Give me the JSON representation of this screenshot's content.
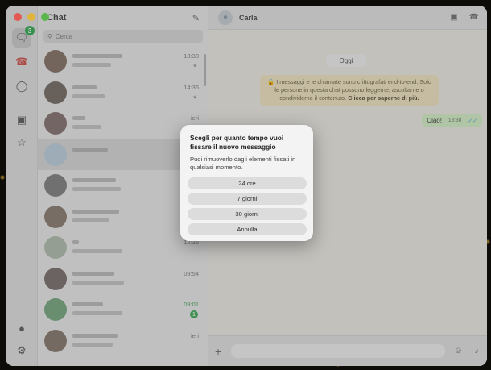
{
  "window": {
    "lights": [
      "close",
      "minimize",
      "zoom"
    ]
  },
  "rail": {
    "chats_badge": "3",
    "icons": [
      "chat-icon",
      "calls-icon",
      "status-icon",
      "archive-icon",
      "starred-icon",
      "meta-ai-icon",
      "settings-icon"
    ]
  },
  "chat_list": {
    "title": "Chat",
    "search_placeholder": "Cerca",
    "rows": [
      {
        "time": "18:30",
        "pinned": true,
        "avatar": "#8b6f5c"
      },
      {
        "time": "14:36",
        "pinned": true,
        "avatar": "#7a6a5f"
      },
      {
        "time": "ieri",
        "pinned": false,
        "avatar": "#8a6e6b"
      },
      {
        "time": "",
        "pinned": false,
        "avatar": "#a3c2d6"
      },
      {
        "time": "",
        "pinned": false,
        "avatar": "#7d7d7d"
      },
      {
        "time": "",
        "pinned": false,
        "avatar": "#8f7866"
      },
      {
        "time": "12:36",
        "pinned": false,
        "avatar": "#9fb39a"
      },
      {
        "time": "09:54",
        "pinned": false,
        "avatar": "#7b6e68"
      },
      {
        "time": "09:01",
        "unread": "1",
        "avatar": "#5aa86a"
      },
      {
        "time": "ieri",
        "pinned": false,
        "avatar": "#8a7566"
      }
    ]
  },
  "conversation": {
    "contact_name": "Carla",
    "date_pill": "Oggi",
    "encryption_notice": "I messaggi e le chiamate sono crittografati end-to-end. Solo le persone in questa chat possono leggerne, ascoltarne o condividerne il contenuto.",
    "encryption_link": "Clicca per saperne di più.",
    "outgoing_message": "Ciao!",
    "outgoing_time": "18:38"
  },
  "modal": {
    "title": "Scegli per quanto tempo vuoi fissare il nuovo messaggio",
    "description": "Puoi rimuoverlo dagli elementi fissati in qualsiasi momento.",
    "options": [
      "24 ore",
      "7 giorni",
      "30 giorni",
      "Annulla"
    ]
  }
}
